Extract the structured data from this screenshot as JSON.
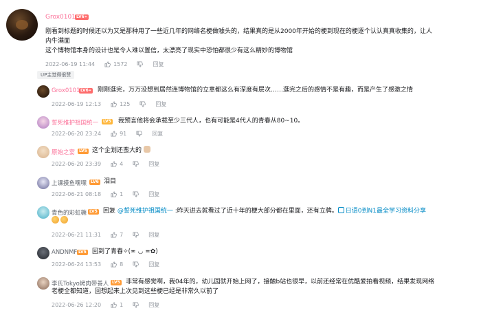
{
  "main_comment": {
    "username": "Grox0101",
    "level": "LV6",
    "text_line1": "刚看到标题的时候还以为又是那种用了一些近几年的网络名梗做噱头的，结果真的是从2000年开始的梗到现在的梗逐个认认真真收集的，让人",
    "text_line2": "内牛满面",
    "text_line3": "这个博物馆本身的设计也是令人难以置信，太漂亮了现实中恐怕都很少有这么精妙的博物馆",
    "time": "2022-06-19 11:44",
    "likes": "1572",
    "reply_label": "回复",
    "badge": "UP主觉得很赞"
  },
  "replies": [
    {
      "username": "Grox0101",
      "level": "LV6",
      "text": "刚刚逛完，万万没想到居然连博物馆的立意都这么有深度有层次……逛完之后的感情不是有趣，而是产生了感激之情",
      "time": "2022-06-19 12:13",
      "likes": "125",
      "reply_label": "回复"
    },
    {
      "username": "誓死维护祖国统一",
      "level": "LV5",
      "text": "我预言他将会承载至少三代人，也有可能是4代人的青春从80~10。",
      "time": "2022-06-20 23:24",
      "likes": "91",
      "reply_label": "回复"
    },
    {
      "username": "原始之宴",
      "level": "LV5",
      "text": "这个企划还蛮大的",
      "time": "2022-06-20 23:39",
      "likes": "4",
      "reply_label": "回复"
    },
    {
      "username": "上课摸鱼嘿嘿",
      "level": "LV6",
      "text": "泪目",
      "time": "2022-06-21 08:18",
      "likes": "1",
      "reply_label": "回复"
    },
    {
      "username": "青色的彩虹糖",
      "level": "LV5",
      "text_prefix": "回复 ",
      "mention": "@誓死维护祖国统一",
      "text_mid": " :昨天进去就看过了近十年的梗大部分都在里面，还有立牌。",
      "search_link": "日语0到N1最全学习资料分享",
      "time": "2022-06-21 11:31",
      "likes": "7",
      "reply_label": "回复"
    },
    {
      "username": "ANDNMF",
      "level": "LV5",
      "text": "回到了青春✧(≖ ◡ ≖✿)",
      "time": "2022-06-24 13:53",
      "likes": "8",
      "reply_label": "回复"
    },
    {
      "username": "李氏Tokyo烤肉带善人",
      "level": "LV5",
      "text_line1": "非常有感觉啊，我04年的，幼儿园就开始上网了，接触b站也很早，以前还经常在优酷爱拍看视频，结果发现网络",
      "text_line2": "老梗全都知道，回想起来上次见到这些梗已经是非常久以前了",
      "time": "2022-06-26 12:20",
      "likes": "1",
      "reply_label": "回复"
    }
  ],
  "colors": {
    "accent_pink": "#fb7299",
    "link_blue": "#008ac5",
    "meta_gray": "#9499a0"
  }
}
